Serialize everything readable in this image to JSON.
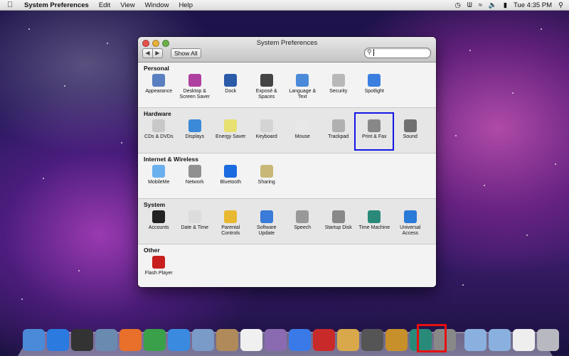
{
  "menubar": {
    "app_name": "System Preferences",
    "menus": [
      "Edit",
      "View",
      "Window",
      "Help"
    ],
    "clock": "Tue 4:35 PM"
  },
  "window": {
    "title": "System Preferences",
    "show_all": "Show All",
    "search": {
      "placeholder": "",
      "value": ""
    },
    "sections": [
      {
        "title": "Personal",
        "items": [
          {
            "label": "Appearance",
            "icon": "appearance-icon",
            "color": "#5a7fc0"
          },
          {
            "label": "Desktop & Screen Saver",
            "icon": "desktop-icon",
            "color": "#b040a0"
          },
          {
            "label": "Dock",
            "icon": "dock-icon",
            "color": "#2a5aa8"
          },
          {
            "label": "Exposé & Spaces",
            "icon": "expose-icon",
            "color": "#444"
          },
          {
            "label": "Language & Text",
            "icon": "language-icon",
            "color": "#4a8ad8"
          },
          {
            "label": "Security",
            "icon": "security-icon",
            "color": "#b8b8b8"
          },
          {
            "label": "Spotlight",
            "icon": "spotlight-icon",
            "color": "#3a7fe0"
          }
        ]
      },
      {
        "title": "Hardware",
        "items": [
          {
            "label": "CDs & DVDs",
            "icon": "cd-icon",
            "color": "#c8c8c8"
          },
          {
            "label": "Displays",
            "icon": "displays-icon",
            "color": "#3a8ad8"
          },
          {
            "label": "Energy Saver",
            "icon": "energy-saver-icon",
            "color": "#e8e070"
          },
          {
            "label": "Keyboard",
            "icon": "keyboard-icon",
            "color": "#d4d4d4"
          },
          {
            "label": "Mouse",
            "icon": "mouse-icon",
            "color": "#e8e8e8"
          },
          {
            "label": "Trackpad",
            "icon": "trackpad-icon",
            "color": "#b0b0b0"
          },
          {
            "label": "Print & Fax",
            "icon": "printer-icon",
            "color": "#888888"
          },
          {
            "label": "Sound",
            "icon": "speaker-icon",
            "color": "#707070"
          }
        ]
      },
      {
        "title": "Internet & Wireless",
        "items": [
          {
            "label": "MobileMe",
            "icon": "mobileme-icon",
            "color": "#6ab0ee"
          },
          {
            "label": "Network",
            "icon": "network-icon",
            "color": "#909090"
          },
          {
            "label": "Bluetooth",
            "icon": "bluetooth-icon",
            "color": "#1a6ae0"
          },
          {
            "label": "Sharing",
            "icon": "sharing-icon",
            "color": "#c8b878"
          }
        ]
      },
      {
        "title": "System",
        "items": [
          {
            "label": "Accounts",
            "icon": "accounts-icon",
            "color": "#222"
          },
          {
            "label": "Date & Time",
            "icon": "clock-icon",
            "color": "#dcdcdc"
          },
          {
            "label": "Parental Controls",
            "icon": "parental-controls-icon",
            "color": "#e8b830"
          },
          {
            "label": "Software Update",
            "icon": "software-update-icon",
            "color": "#3a7ad8"
          },
          {
            "label": "Speech",
            "icon": "microphone-icon",
            "color": "#999"
          },
          {
            "label": "Startup Disk",
            "icon": "disk-icon",
            "color": "#888"
          },
          {
            "label": "Time Machine",
            "icon": "time-machine-icon",
            "color": "#2a8a7a"
          },
          {
            "label": "Universal Access",
            "icon": "universal-access-icon",
            "color": "#2a7ad8"
          }
        ]
      },
      {
        "title": "Other",
        "items": [
          {
            "label": "Flash Player",
            "icon": "flash-player-icon",
            "color": "#c81e1e"
          }
        ]
      }
    ]
  },
  "dock": {
    "items": [
      {
        "icon": "finder-icon",
        "color": "#4a8ad8"
      },
      {
        "icon": "app-store-icon",
        "color": "#2a7ae0"
      },
      {
        "icon": "dashboard-icon",
        "color": "#333"
      },
      {
        "icon": "mail-icon",
        "color": "#6a8ab0"
      },
      {
        "icon": "firefox-icon",
        "color": "#e8702a"
      },
      {
        "icon": "chrome-icon",
        "color": "#3aa04a"
      },
      {
        "icon": "safari-icon",
        "color": "#3a8ae0"
      },
      {
        "icon": "facetime-icon",
        "color": "#7a9ac8"
      },
      {
        "icon": "address-book-icon",
        "color": "#b08a5a"
      },
      {
        "icon": "calendar-icon",
        "color": "#f0f0f0"
      },
      {
        "icon": "photos-icon",
        "color": "#8a6ab0"
      },
      {
        "icon": "itunes-icon",
        "color": "#3a7ae8"
      },
      {
        "icon": "photo-booth-icon",
        "color": "#c82a2a"
      },
      {
        "icon": "iphoto-icon",
        "color": "#d8a84a"
      },
      {
        "icon": "imovie-icon",
        "color": "#555"
      },
      {
        "icon": "garageband-icon",
        "color": "#c8902a"
      },
      {
        "icon": "time-machine-icon",
        "color": "#2a8a7a"
      },
      {
        "icon": "system-preferences-icon",
        "color": "#888"
      },
      {
        "icon": "sep",
        "color": ""
      },
      {
        "icon": "applications-folder-icon",
        "color": "#8ab0e0"
      },
      {
        "icon": "documents-folder-icon",
        "color": "#8ab0e0"
      },
      {
        "icon": "document-icon",
        "color": "#eeeeee"
      },
      {
        "icon": "trash-icon",
        "color": "#b8b8c0"
      }
    ]
  }
}
